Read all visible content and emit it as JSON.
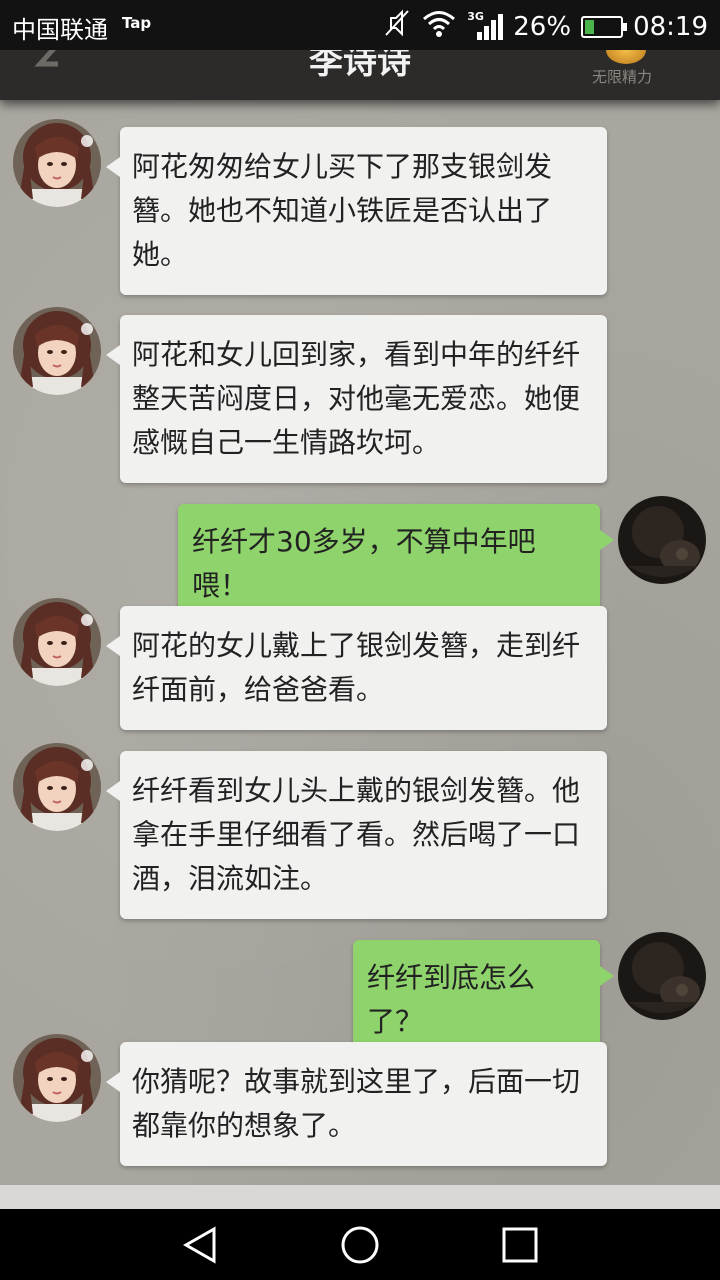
{
  "status_bar": {
    "carrier": "中国联通",
    "tap_badge": "Tap",
    "network": "3G",
    "battery_percent": 26,
    "battery_text": "26%",
    "time": "08:19",
    "icons": [
      "mute-icon",
      "wifi-icon",
      "signal-icon",
      "battery-icon"
    ]
  },
  "header": {
    "title": "李诗诗",
    "energy_label": "无限精力",
    "back_icon": "back-arrow-icon",
    "energy_icon": "energy-badge-icon"
  },
  "messages": [
    {
      "side": "left",
      "text": "阿花匆匆给女儿买下了那支银剑发簪。她也不知道小铁匠是否认出了她。"
    },
    {
      "side": "left",
      "text": "阿花和女儿回到家，看到中年的纤纤整天苦闷度日，对他毫无爱恋。她便感慨自己一生情路坎坷。"
    },
    {
      "side": "right",
      "text": "纤纤才30多岁，不算中年吧喂！"
    },
    {
      "side": "left",
      "text": "阿花的女儿戴上了银剑发簪，走到纤纤面前，给爸爸看。"
    },
    {
      "side": "left",
      "text": "纤纤看到女儿头上戴的银剑发簪。他拿在手里仔细看了看。然后喝了一口酒，泪流如注。"
    },
    {
      "side": "right",
      "text": "纤纤到底怎么了？"
    },
    {
      "side": "left",
      "text": "你猜呢？故事就到这里了，后面一切都靠你的想象了。"
    }
  ],
  "nav_bar": {
    "icons": [
      "back-triangle-icon",
      "home-circle-icon",
      "recents-square-icon"
    ]
  },
  "colors": {
    "incoming_bubble": "#f1f1f0",
    "outgoing_bubble": "#8ed36b",
    "battery_fill": "#4bb34b"
  }
}
